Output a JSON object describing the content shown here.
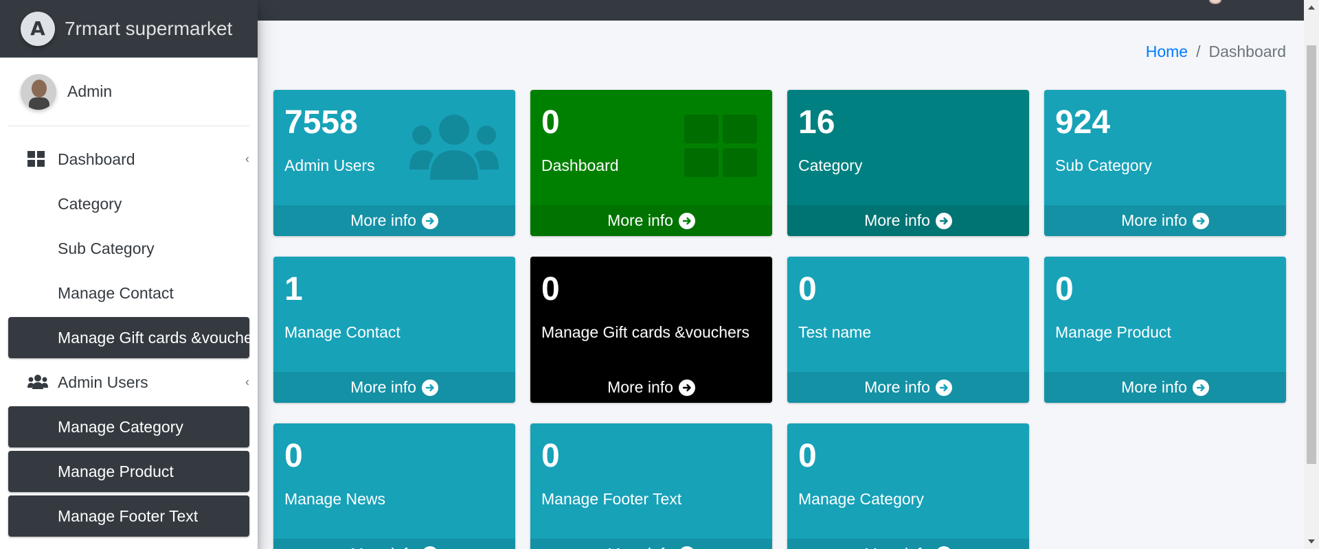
{
  "brand": {
    "name": "7rmart supermarket",
    "logo_letter": "A"
  },
  "user": {
    "name": "Admin"
  },
  "sidebar": {
    "items": [
      {
        "label": "Dashboard",
        "icon": "dashboard-grid-icon",
        "active": false,
        "caret": "‹"
      },
      {
        "label": "Category",
        "active": false
      },
      {
        "label": "Sub Category",
        "active": false
      },
      {
        "label": "Manage Contact",
        "active": false
      },
      {
        "label": "Manage Gift cards &vouchers",
        "active": true
      },
      {
        "label": "Admin Users",
        "icon": "users-icon",
        "active": false,
        "caret": "‹"
      },
      {
        "label": "Manage Category",
        "active": true
      },
      {
        "label": "Manage Product",
        "active": true
      },
      {
        "label": "Manage Footer Text",
        "active": true
      }
    ]
  },
  "breadcrumb": {
    "home": "Home",
    "separator": "/",
    "current": "Dashboard"
  },
  "colors": {
    "info": "#17a2b8",
    "success": "#008000",
    "teal": "#008080",
    "black": "#000000",
    "sidebar_active": "#343a40",
    "link": "#007bff"
  },
  "cards": [
    {
      "count": "7558",
      "label": "Admin Users",
      "footer": "More info",
      "color": "#17a2b8",
      "icon": "users-icon"
    },
    {
      "count": "0",
      "label": "Dashboard",
      "footer": "More info",
      "color": "#008000",
      "icon": "dashboard-grid-icon"
    },
    {
      "count": "16",
      "label": "Category",
      "footer": "More info",
      "color": "#008080",
      "icon": ""
    },
    {
      "count": "924",
      "label": "Sub Category",
      "footer": "More info",
      "color": "#17a2b8",
      "icon": ""
    },
    {
      "count": "1",
      "label": "Manage Contact",
      "footer": "More info",
      "color": "#17a2b8",
      "icon": ""
    },
    {
      "count": "0",
      "label": "Manage Gift cards &vouchers",
      "footer": "More info",
      "color": "#000000",
      "icon": ""
    },
    {
      "count": "0",
      "label": "Test name",
      "footer": "More info",
      "color": "#17a2b8",
      "icon": ""
    },
    {
      "count": "0",
      "label": "Manage Product",
      "footer": "More info",
      "color": "#17a2b8",
      "icon": ""
    },
    {
      "count": "0",
      "label": "Manage News",
      "footer": "More info",
      "color": "#17a2b8",
      "icon": ""
    },
    {
      "count": "0",
      "label": "Manage Footer Text",
      "footer": "More info",
      "color": "#17a2b8",
      "icon": ""
    },
    {
      "count": "0",
      "label": "Manage Category",
      "footer": "More info",
      "color": "#17a2b8",
      "icon": ""
    }
  ]
}
